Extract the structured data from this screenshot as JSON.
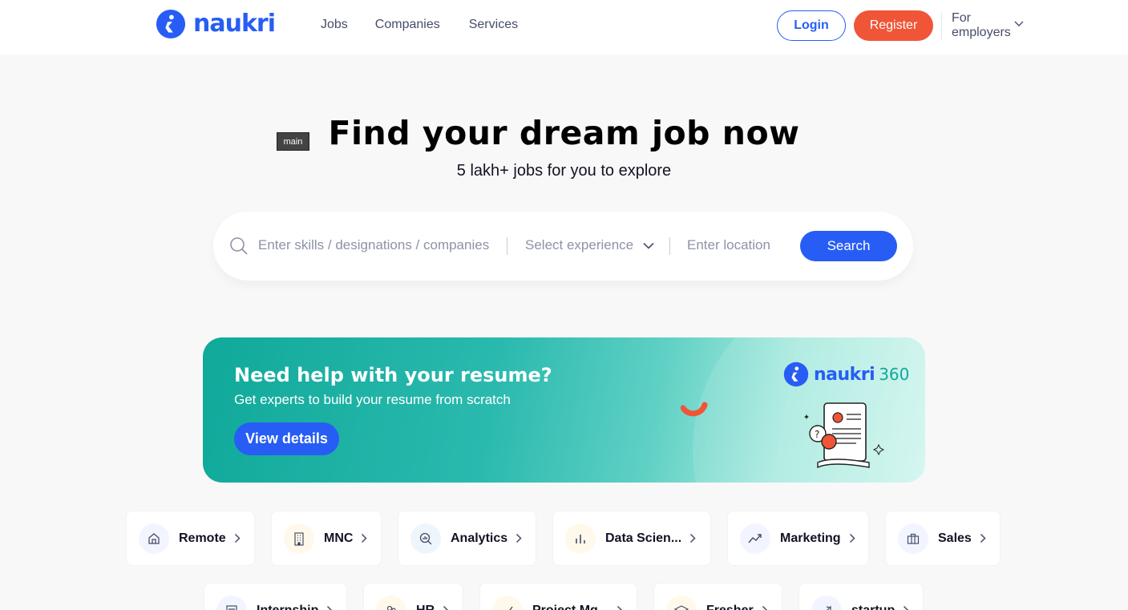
{
  "header": {
    "logo_text": "naukri",
    "nav": [
      "Jobs",
      "Companies",
      "Services"
    ],
    "login_label": "Login",
    "register_label": "Register",
    "employers_label": "For employers"
  },
  "tooltip": "main",
  "hero": {
    "title": "Find your dream job now",
    "subtitle": "5 lakh+ jobs for you to explore"
  },
  "search": {
    "skills_placeholder": "Enter skills / designations / companies",
    "experience_placeholder": "Select experience",
    "location_placeholder": "Enter location",
    "button_label": "Search"
  },
  "banner": {
    "title": "Need help with your resume?",
    "subtitle": "Get experts to build your resume from scratch",
    "button_label": "View details",
    "brand_text": "naukri",
    "brand_number": "360"
  },
  "categories": [
    {
      "label": "Remote",
      "icon": "home-icon"
    },
    {
      "label": "MNC",
      "icon": "building-icon"
    },
    {
      "label": "Analytics",
      "icon": "analytics-icon"
    },
    {
      "label": "Data Scien...",
      "icon": "bar-chart-icon"
    },
    {
      "label": "Marketing",
      "icon": "trend-up-icon"
    },
    {
      "label": "Sales",
      "icon": "briefcase-icon"
    },
    {
      "label": "Internship",
      "icon": "document-icon"
    },
    {
      "label": "HR",
      "icon": "people-icon"
    },
    {
      "label": "Project Mg...",
      "icon": "check-icon"
    },
    {
      "label": "Fresher",
      "icon": "graduation-icon"
    },
    {
      "label": "startup",
      "icon": "rocket-icon"
    }
  ],
  "colors": {
    "brand_blue": "#275df5",
    "register_orange": "#f05537",
    "banner_teal": "#10a99a"
  }
}
